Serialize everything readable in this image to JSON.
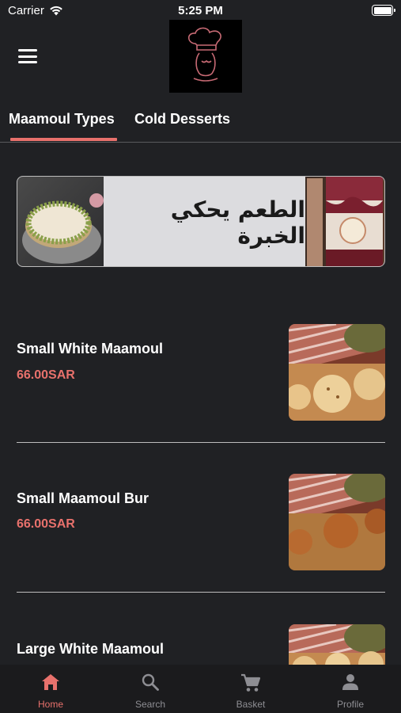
{
  "status_bar": {
    "carrier": "Carrier",
    "time": "5:25 PM"
  },
  "header": {
    "menu_icon": "hamburger-menu-icon",
    "logo_icon": "chef-hat-logo"
  },
  "tabs": [
    {
      "label": "Maamoul Types",
      "active": true
    },
    {
      "label": "Cold Desserts",
      "active": false
    }
  ],
  "banner": {
    "text": "الطعم يحكي الخبرة"
  },
  "products": [
    {
      "name": "Small White Maamoul",
      "price": "66.00SAR"
    },
    {
      "name": "Small Maamoul Bur",
      "price": "66.00SAR"
    },
    {
      "name": "Large White Maamoul",
      "price": ""
    }
  ],
  "bottom_nav": [
    {
      "label": "Home",
      "icon": "home-icon",
      "active": true
    },
    {
      "label": "Search",
      "icon": "search-icon",
      "active": false
    },
    {
      "label": "Basket",
      "icon": "cart-icon",
      "active": false
    },
    {
      "label": "Profile",
      "icon": "person-icon",
      "active": false
    }
  ],
  "colors": {
    "background": "#202124",
    "accent": "#e8716c",
    "nav_background": "#1b1b1d",
    "inactive": "#8e8e93"
  }
}
